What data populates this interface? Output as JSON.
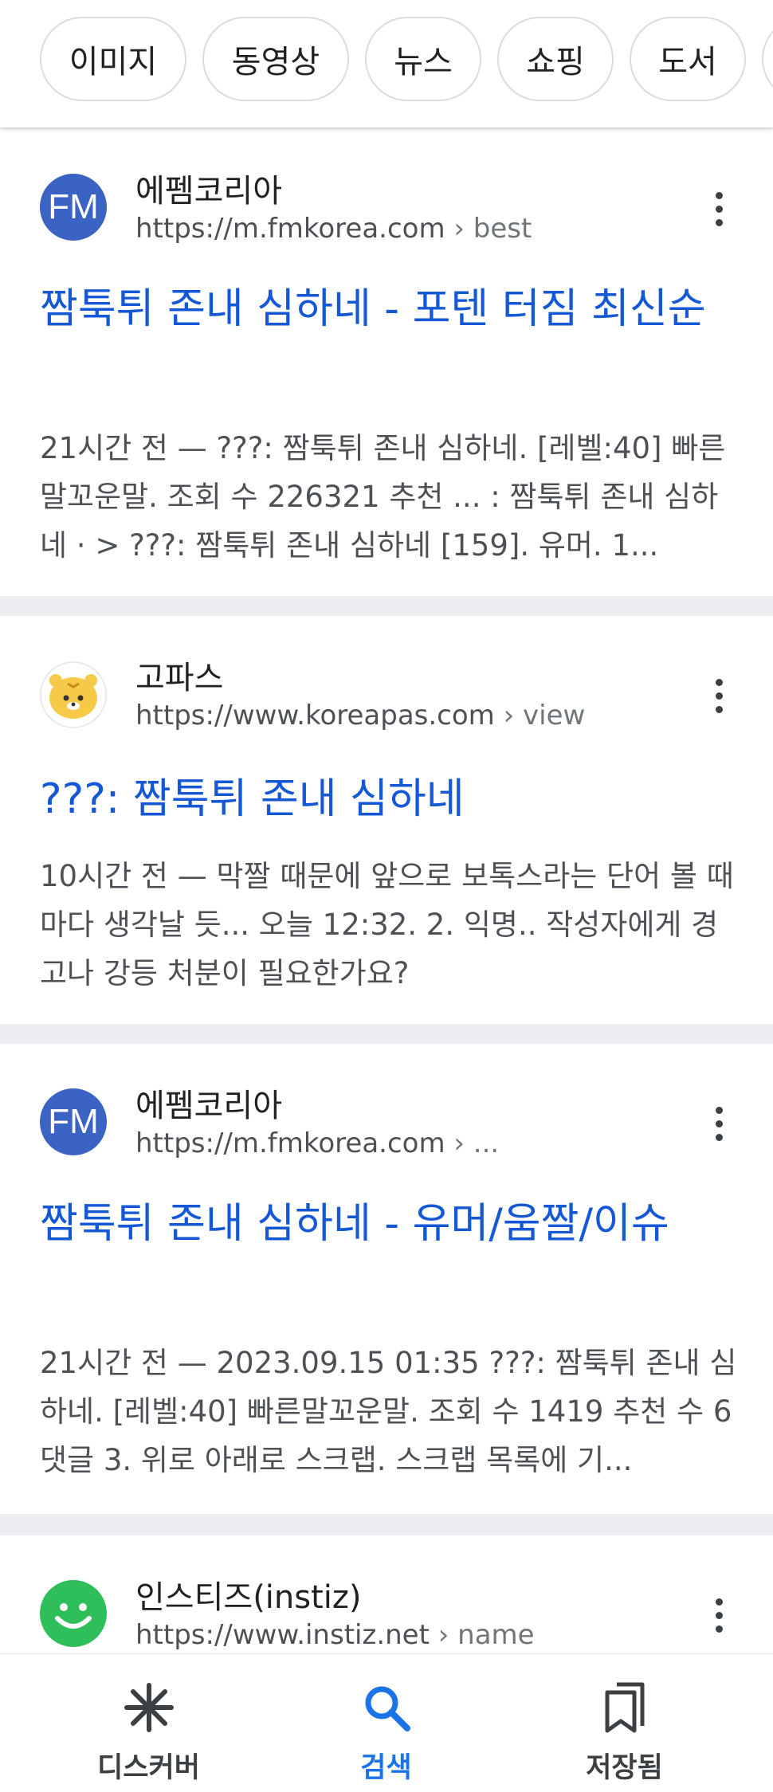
{
  "filter_chips": [
    "이미지",
    "동영상",
    "뉴스",
    "쇼핑",
    "도서"
  ],
  "results": [
    {
      "site_name": "에펨코리아",
      "url": "https://m.fmkorea.com",
      "breadcrumb": "› best",
      "favicon": "FM",
      "favicon_color": "#3b63c4",
      "title": "짬툭튀 존내 심하네 - 포텐 터짐 최신순",
      "snippet": "21시간 전 — ???: 짬툭튀 존내 심하네. [레벨:40] 빠른말꼬운말. 조회 수 226321 추천 ... : 짬툭튀 존내 심하네 · > ???: 짬툭튀 존내 심하네 [159]. 유머. 1..."
    },
    {
      "site_name": "고파스",
      "url": "https://www.koreapas.com",
      "breadcrumb": "› view",
      "favicon": "tiger-icon",
      "title": "???: 짬툭튀 존내 심하네",
      "snippet": "10시간 전 — 막짤 때문에 앞으로 보톡스라는 단어 볼 때마다 생각날 듯... 오늘 12:32. 2. 익명.. 작성자에게 경고나 강등 처분이 필요한가요?"
    },
    {
      "site_name": "에펨코리아",
      "url": "https://m.fmkorea.com",
      "breadcrumb": "› ...",
      "favicon": "FM",
      "favicon_color": "#3b63c4",
      "title": "짬툭튀 존내 심하네 - 유머/움짤/이슈",
      "snippet": "21시간 전 — 2023.09.15 01:35 ???: 짬툭튀 존내 심하네. [레벨:40] 빠른말꼬운말. 조회 수 1419 추천 수 6 댓글 3. 위로 아래로 스크랩. 스크랩 목록에 기..."
    },
    {
      "site_name": "인스티즈(instiz)",
      "url": "https://www.instiz.net",
      "breadcrumb": "› name",
      "favicon": "smiley-icon",
      "favicon_color": "#2fbf5a"
    }
  ],
  "bottom_nav": {
    "discover": "디스커버",
    "search": "검색",
    "saved": "저장됨",
    "active": "search",
    "accent_color": "#1a73e8"
  }
}
